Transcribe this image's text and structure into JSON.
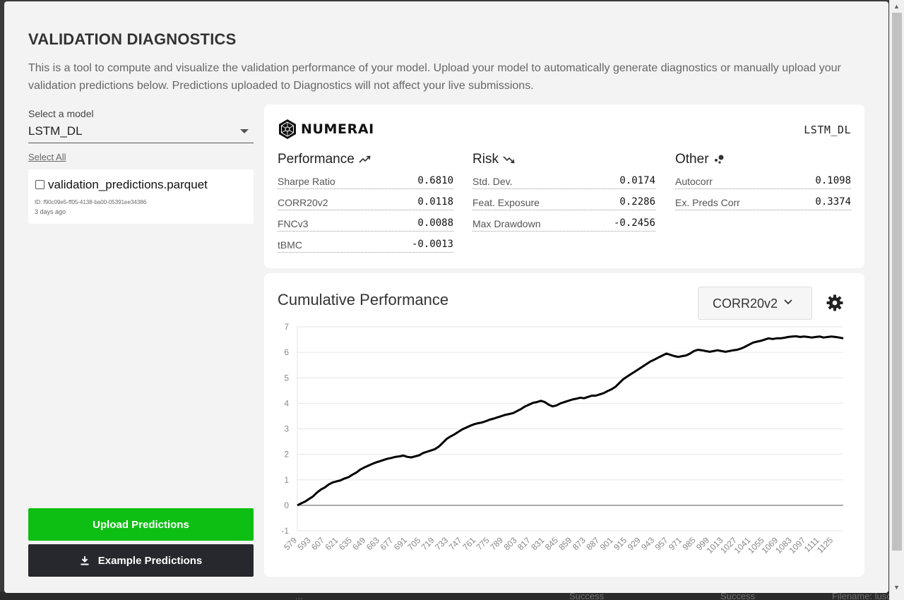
{
  "header": {
    "title": "VALIDATION DIAGNOSTICS",
    "description": "This is a tool to compute and visualize the validation performance of your model. Upload your model to automatically generate diagnostics or manually upload your validation predictions below. Predictions uploaded to Diagnostics will not affect your live submissions."
  },
  "sidebar": {
    "select_label": "Select a model",
    "selected_model": "LSTM_DL",
    "select_all": "Select All",
    "file": {
      "name": "validation_predictions.parquet",
      "id": "ID: f90c09e5-ff05-4138-ba00-05391ee34386",
      "time": "3 days ago",
      "checked": false
    },
    "upload_button": "Upload Predictions",
    "example_button": "Example Predictions"
  },
  "metrics": {
    "brand": "NUMERAI",
    "model_name": "LSTM_DL",
    "performance": {
      "title": "Performance",
      "items": [
        {
          "label": "Sharpe Ratio",
          "value": "0.6810"
        },
        {
          "label": "CORR20v2",
          "value": "0.0118"
        },
        {
          "label": "FNCv3",
          "value": "0.0088"
        },
        {
          "label": "tBMC",
          "value": "-0.0013"
        }
      ]
    },
    "risk": {
      "title": "Risk",
      "items": [
        {
          "label": "Std. Dev.",
          "value": "0.0174"
        },
        {
          "label": "Feat. Exposure",
          "value": "0.2286"
        },
        {
          "label": "Max Drawdown",
          "value": "-0.2456"
        }
      ]
    },
    "other": {
      "title": "Other",
      "items": [
        {
          "label": "Autocorr",
          "value": "0.1098"
        },
        {
          "label": "Ex. Preds Corr",
          "value": "0.3374"
        }
      ]
    }
  },
  "chart_panel": {
    "title": "Cumulative Performance",
    "metric_selector": "CORR20v2"
  },
  "backdrop": {
    "left": "...",
    "mid1": "Success",
    "mid2": "Success",
    "right": "Filename: lusc"
  },
  "colors": {
    "upload_button": "#0ebf13",
    "example_button": "#26282d",
    "line": "#000000"
  },
  "chart_data": {
    "type": "line",
    "title": "Cumulative Performance",
    "xlabel": "",
    "ylabel": "",
    "ylim": [
      -1,
      7
    ],
    "yticks": [
      -1,
      0,
      1,
      2,
      3,
      4,
      5,
      6,
      7
    ],
    "xlim": [
      579,
      1135
    ],
    "xticks": [
      579,
      593,
      607,
      621,
      635,
      649,
      663,
      677,
      691,
      705,
      719,
      733,
      747,
      761,
      775,
      789,
      803,
      817,
      831,
      845,
      859,
      873,
      887,
      901,
      915,
      929,
      943,
      957,
      971,
      985,
      999,
      1013,
      1027,
      1041,
      1055,
      1069,
      1083,
      1097,
      1111,
      1125
    ],
    "grid": true,
    "series": [
      {
        "x": [
          579,
          583,
          587,
          591,
          595,
          599,
          603,
          607,
          611,
          615,
          619,
          623,
          627,
          631,
          635,
          639,
          643,
          647,
          651,
          655,
          659,
          663,
          667,
          671,
          675,
          679,
          683,
          687,
          691,
          695,
          699,
          703,
          707,
          711,
          715,
          719,
          723,
          727,
          731,
          735,
          739,
          743,
          747,
          751,
          755,
          759,
          763,
          767,
          771,
          775,
          779,
          783,
          787,
          791,
          795,
          799,
          803,
          807,
          811,
          815,
          819,
          823,
          827,
          831,
          835,
          839,
          843,
          847,
          851,
          855,
          859,
          863,
          867,
          871,
          875,
          879,
          883,
          887,
          891,
          895,
          899,
          903,
          907,
          911,
          915,
          919,
          923,
          927,
          931,
          935,
          939,
          943,
          947,
          951,
          955,
          959,
          963,
          967,
          971,
          975,
          979,
          983,
          987,
          991,
          995,
          999,
          1003,
          1007,
          1011,
          1015,
          1019,
          1023,
          1027,
          1031,
          1035,
          1039,
          1043,
          1047,
          1051,
          1055,
          1059,
          1063,
          1067,
          1071,
          1075,
          1079,
          1083,
          1087,
          1091,
          1095,
          1099,
          1103,
          1107,
          1111,
          1115,
          1119,
          1123,
          1127,
          1131,
          1135
        ],
        "y": [
          0.0,
          0.08,
          0.15,
          0.25,
          0.35,
          0.5,
          0.62,
          0.7,
          0.82,
          0.9,
          0.94,
          0.98,
          1.05,
          1.1,
          1.2,
          1.28,
          1.4,
          1.48,
          1.55,
          1.62,
          1.68,
          1.73,
          1.78,
          1.83,
          1.86,
          1.9,
          1.92,
          1.95,
          1.9,
          1.88,
          1.92,
          1.96,
          2.05,
          2.1,
          2.15,
          2.2,
          2.3,
          2.45,
          2.6,
          2.7,
          2.78,
          2.88,
          2.98,
          3.05,
          3.12,
          3.18,
          3.22,
          3.25,
          3.3,
          3.36,
          3.4,
          3.45,
          3.5,
          3.55,
          3.58,
          3.62,
          3.7,
          3.78,
          3.88,
          3.95,
          4.02,
          4.05,
          4.1,
          4.05,
          3.95,
          3.88,
          3.92,
          4.0,
          4.05,
          4.1,
          4.15,
          4.18,
          4.22,
          4.2,
          4.25,
          4.3,
          4.3,
          4.35,
          4.4,
          4.48,
          4.55,
          4.65,
          4.8,
          4.95,
          5.05,
          5.15,
          5.25,
          5.35,
          5.45,
          5.55,
          5.65,
          5.72,
          5.8,
          5.88,
          5.95,
          5.9,
          5.85,
          5.82,
          5.85,
          5.88,
          5.95,
          6.05,
          6.1,
          6.08,
          6.05,
          6.02,
          6.05,
          6.08,
          6.05,
          6.02,
          6.05,
          6.08,
          6.1,
          6.15,
          6.22,
          6.3,
          6.38,
          6.42,
          6.45,
          6.5,
          6.55,
          6.52,
          6.55,
          6.55,
          6.57,
          6.6,
          6.62,
          6.63,
          6.6,
          6.62,
          6.6,
          6.58,
          6.6,
          6.62,
          6.58,
          6.6,
          6.62,
          6.6,
          6.58,
          6.55
        ]
      }
    ]
  }
}
